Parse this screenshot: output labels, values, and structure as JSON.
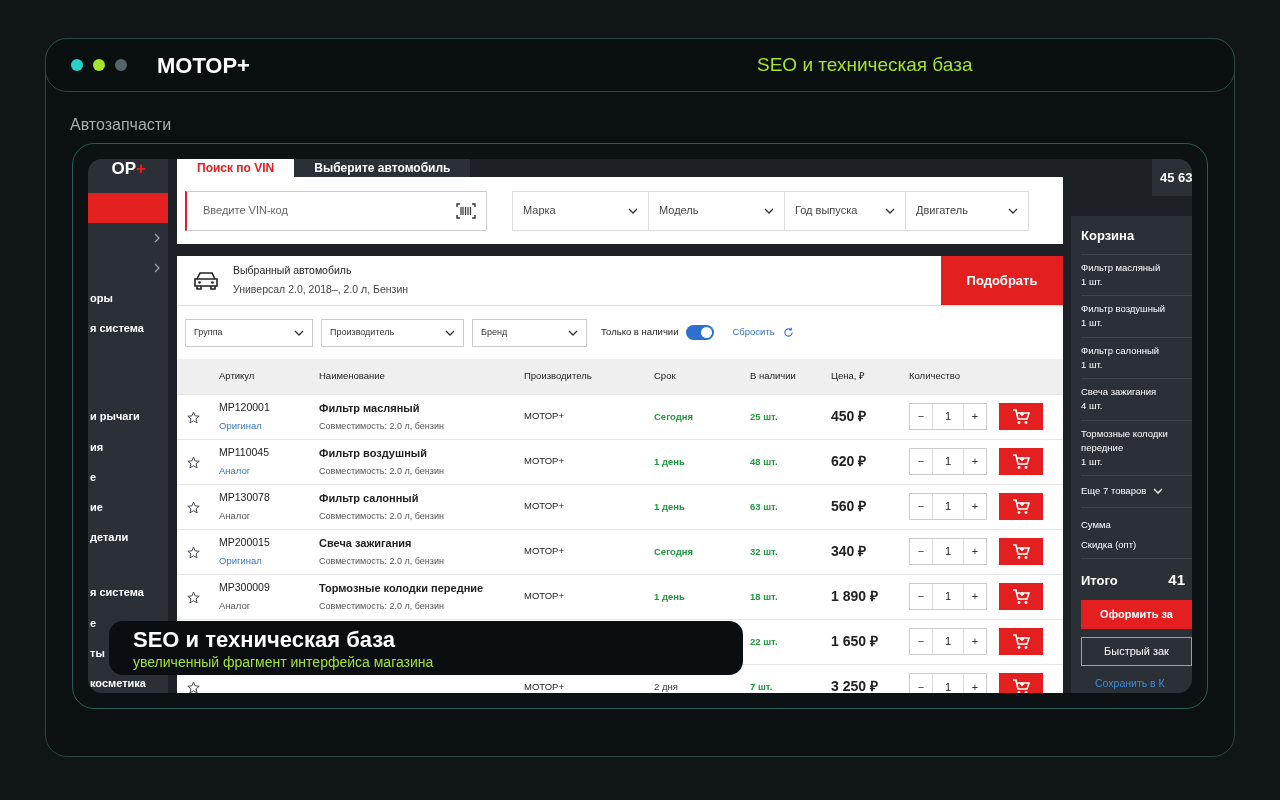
{
  "header": {
    "brand": "МОТОР+",
    "tagline": "SEO и техническая база"
  },
  "section_label": "Автозапчасти",
  "shop": {
    "logo": "ОР+",
    "sidebar": {
      "items": [
        {
          "kind": "accent"
        },
        {
          "kind": "chevron"
        },
        {
          "kind": "chevron"
        },
        {
          "kind": "text",
          "label": "оры"
        },
        {
          "kind": "text",
          "label": "я система"
        },
        {
          "kind": "text",
          "label": "и рычаги"
        },
        {
          "kind": "text",
          "label": "ия"
        },
        {
          "kind": "text",
          "label": "е"
        },
        {
          "kind": "text",
          "label": "ие"
        },
        {
          "kind": "text",
          "label": "детали"
        },
        {
          "kind": "text",
          "label": "я система"
        },
        {
          "kind": "text",
          "label": "е"
        },
        {
          "kind": "text",
          "label": "ты"
        },
        {
          "kind": "text",
          "label": "косметика"
        }
      ]
    },
    "tabs": [
      {
        "label": "Поиск по VIN",
        "selected": true
      },
      {
        "label": "Выберите автомобиль",
        "selected": false
      }
    ],
    "vin": {
      "placeholder": "Введите VIN-код"
    },
    "selects": [
      {
        "label": "Марка"
      },
      {
        "label": "Модель"
      },
      {
        "label": "Год выпуска"
      },
      {
        "label": "Двигатель"
      }
    ],
    "car": {
      "title": "Выбранный автомобиль",
      "details": "Универсал 2.0, 2018–, 2.0 л, Бензин",
      "button": "Подобрать"
    },
    "filters": [
      {
        "label": "Группа"
      },
      {
        "label": "Производитель"
      },
      {
        "label": "Бренд"
      }
    ],
    "in_stock": {
      "label": "Только в наличии",
      "on": true
    },
    "reset": "Сбросить",
    "table": {
      "columns": [
        "Артикул",
        "Наименование",
        "Производитель",
        "Срок",
        "В наличии",
        "Цена, ₽",
        "Количество"
      ],
      "rows": [
        {
          "favorite": false,
          "article": "МР120001",
          "tag": "Оригинал",
          "tag_link": true,
          "name": "Фильтр масляный",
          "compat": "Совместимость: 2.0 л, бензин",
          "maker": "МОТОР+",
          "term": "Сегодня",
          "term_fast": true,
          "stock": "25 шт.",
          "price": "450 ₽",
          "minus": "−",
          "qty": "1",
          "plus": "+"
        },
        {
          "favorite": false,
          "article": "МР110045",
          "tag": "Аналог",
          "tag_link": true,
          "name": "Фильтр воздушный",
          "compat": "Совместимость: 2.0 л, бензин",
          "maker": "МОТОР+",
          "term": "1 день",
          "term_fast": true,
          "stock": "48 шт.",
          "price": "620 ₽",
          "minus": "−",
          "qty": "1",
          "plus": "+"
        },
        {
          "favorite": false,
          "article": "МР130078",
          "tag": "Аналог",
          "tag_link": false,
          "name": "Фильтр салонный",
          "compat": "Совместимость: 2.0 л, бензин",
          "maker": "МОТОР+",
          "term": "1 день",
          "term_fast": true,
          "stock": "63 шт.",
          "price": "560 ₽",
          "minus": "−",
          "qty": "1",
          "plus": "+"
        },
        {
          "favorite": false,
          "article": "МР200015",
          "tag": "Оригинал",
          "tag_link": true,
          "name": "Свеча зажигания",
          "compat": "Совместимость: 2.0 л, бензин",
          "maker": "МОТОР+",
          "term": "Сегодня",
          "term_fast": true,
          "stock": "32 шт.",
          "price": "340 ₽",
          "minus": "−",
          "qty": "1",
          "plus": "+"
        },
        {
          "favorite": false,
          "article": "МР300009",
          "tag": "Аналог",
          "tag_link": false,
          "name": "Тормозные колодки передние",
          "compat": "Совместимость: 2.0 л, бензин",
          "maker": "МОТОР+",
          "term": "1 день",
          "term_fast": true,
          "stock": "18 шт.",
          "price": "1 890 ₽",
          "minus": "−",
          "qty": "1",
          "plus": "+"
        },
        {
          "stock": "22 шт.",
          "price": "1 650 ₽",
          "minus": "−",
          "qty": "1",
          "plus": "+"
        },
        {
          "favorite": false,
          "maker": "МОТОР+",
          "term": "2 дня",
          "term_fast": false,
          "stock": "7 шт.",
          "price": "3 250 ₽",
          "minus": "−",
          "qty": "1",
          "plus": "+"
        }
      ]
    },
    "phone": "45 63",
    "cart": {
      "title": "Корзина",
      "items": [
        {
          "name": "Фильтр масляный",
          "qty": "1 шт."
        },
        {
          "name": "Фильтр воздушный",
          "qty": "1 шт."
        },
        {
          "name": "Фильтр салонный",
          "qty": "1 шт."
        },
        {
          "name": "Свеча зажигания",
          "qty": "4 шт."
        },
        {
          "name": "Тормозные колодки передние",
          "qty": "1 шт."
        }
      ],
      "more": "Еще 7 товаров",
      "sum_label": "Сумма",
      "discount_label": "Скидка (опт)",
      "total_label": "Итого",
      "total": "41",
      "checkout": "Оформить за",
      "quick": "Быстрый зак",
      "save": "Сохранить в К"
    }
  },
  "caption": {
    "title": "SEO и техническая база",
    "subtitle": "увеличенный фрагмент интерфейса магазина"
  }
}
